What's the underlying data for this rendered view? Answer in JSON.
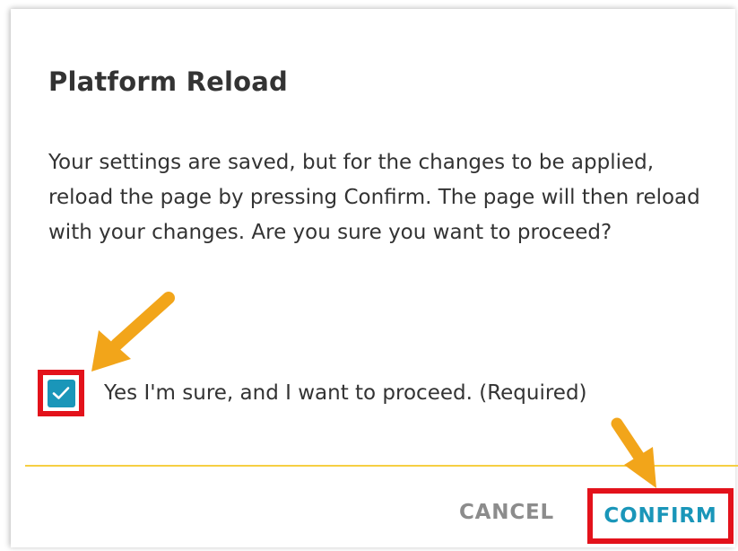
{
  "dialog": {
    "title": "Platform Reload",
    "message": "Your settings are saved, but for the changes to be applied, reload the page by pressing Confirm. The page will then reload with your changes. Are you sure you want to proceed?",
    "checkbox": {
      "checked": true,
      "label": "Yes I'm sure, and I want to proceed. (Required)"
    },
    "buttons": {
      "cancel_label": "CANCEL",
      "confirm_label": "CONFIRM"
    }
  },
  "annotations": {
    "arrows": [
      "pointer-arrow-to-checkbox",
      "pointer-arrow-to-confirm"
    ],
    "highlight_color": "#e3121b",
    "arrow_color": "#f2a51a"
  },
  "colors": {
    "accent": "#1a96b9",
    "divider": "#f6cf43",
    "text": "#333333",
    "cancel": "#8c8c8c"
  }
}
